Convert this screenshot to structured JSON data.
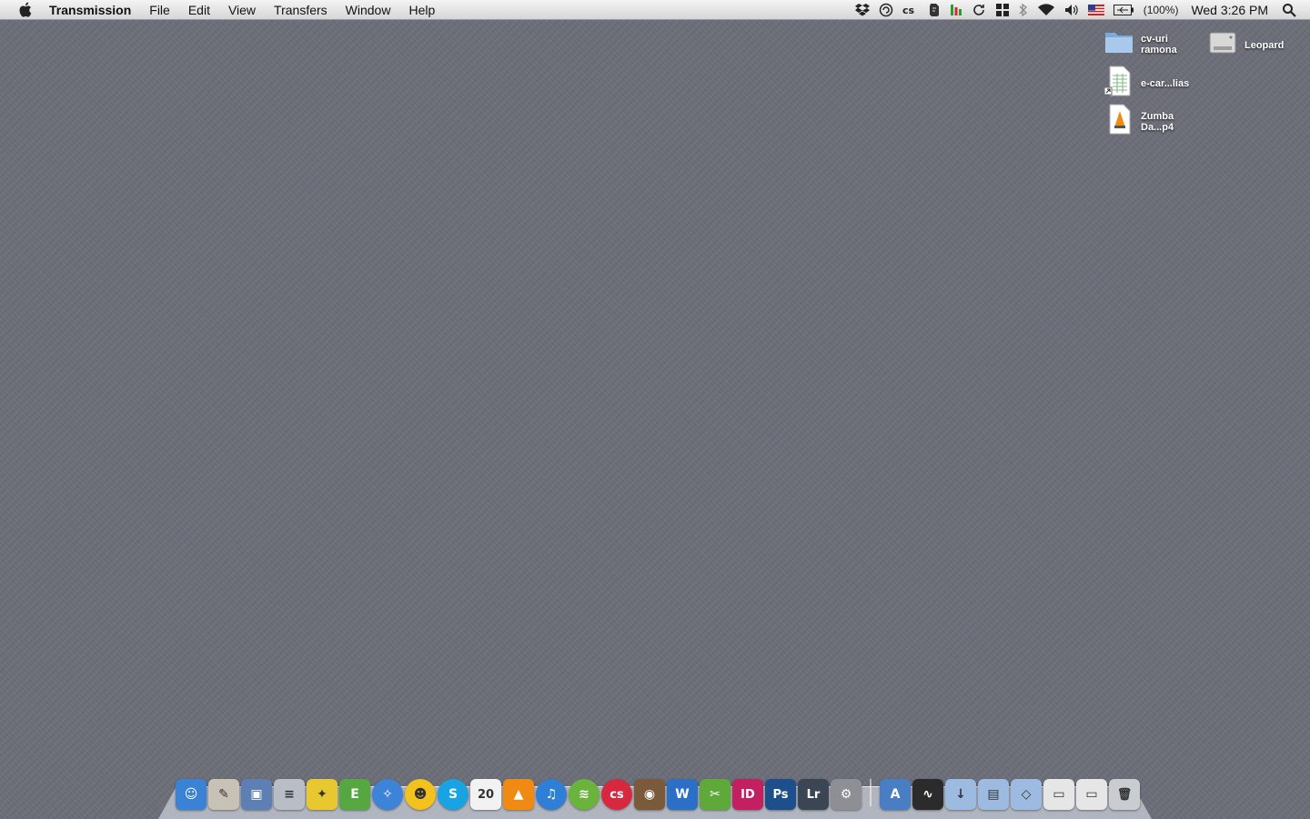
{
  "menubar": {
    "app_name": "Transmission",
    "menus": [
      "File",
      "Edit",
      "View",
      "Transfers",
      "Window",
      "Help"
    ],
    "battery_text": "(100%)",
    "clock": "Wed 3:26 PM"
  },
  "desktop": {
    "icons": [
      {
        "label": "cv-uri ramona",
        "icon": "folder-icon"
      },
      {
        "label": "Leopard",
        "icon": "hard-drive-icon"
      },
      {
        "label": "e-car...lias",
        "icon": "spreadsheet-file-icon"
      },
      {
        "label": "Zumba Da...p4",
        "icon": "vlc-video-file-icon"
      }
    ]
  },
  "dock": {
    "apps": [
      {
        "name": "Finder",
        "icon": "finder-icon",
        "glyph": "☺",
        "color": "#3a82d6"
      },
      {
        "name": "Script Editor",
        "icon": "script-icon",
        "glyph": "✎",
        "color": "#c8c2b6"
      },
      {
        "name": "Preview",
        "icon": "preview-icon",
        "glyph": "▣",
        "color": "#5d7fb3"
      },
      {
        "name": "News",
        "icon": "newspaper-icon",
        "glyph": "≡",
        "color": "#b9bec6"
      },
      {
        "name": "Twitter",
        "icon": "bird-icon",
        "glyph": "✦",
        "color": "#e8c830"
      },
      {
        "name": "Evernote",
        "icon": "elephant-icon",
        "glyph": "E",
        "color": "#56a642"
      },
      {
        "name": "Safari",
        "icon": "compass-icon",
        "glyph": "✧",
        "color": "#3d83d8"
      },
      {
        "name": "Yahoo Messenger",
        "icon": "smiley-icon",
        "glyph": "☻",
        "color": "#f3c21d"
      },
      {
        "name": "Skype",
        "icon": "skype-icon",
        "glyph": "S",
        "color": "#19a3e3"
      },
      {
        "name": "iCal",
        "icon": "calendar-icon",
        "glyph": "20",
        "color": "#f2f2f2"
      },
      {
        "name": "VLC",
        "icon": "traffic-cone-icon",
        "glyph": "▲",
        "color": "#f08a12"
      },
      {
        "name": "iTunes",
        "icon": "music-note-icon",
        "glyph": "♫",
        "color": "#2f7fd6"
      },
      {
        "name": "Spotify",
        "icon": "spotify-icon",
        "glyph": "≋",
        "color": "#6cb33e"
      },
      {
        "name": "Last.fm",
        "icon": "lastfm-icon",
        "glyph": "cs",
        "color": "#d7283f"
      },
      {
        "name": "iPhoto",
        "icon": "camera-photo-icon",
        "glyph": "◉",
        "color": "#7a5a3a"
      },
      {
        "name": "Word",
        "icon": "word-icon",
        "glyph": "W",
        "color": "#2c6fc6"
      },
      {
        "name": "Dreamweaver",
        "icon": "scissors-icon",
        "glyph": "✂",
        "color": "#5fa83a"
      },
      {
        "name": "InDesign",
        "icon": "indesign-icon",
        "glyph": "ID",
        "color": "#c22060"
      },
      {
        "name": "Photoshop",
        "icon": "photoshop-icon",
        "glyph": "Ps",
        "color": "#1c4f8c"
      },
      {
        "name": "Lightroom",
        "icon": "lightroom-icon",
        "glyph": "Lr",
        "color": "#3a4654"
      },
      {
        "name": "System Preferences",
        "icon": "gear-icon",
        "glyph": "⚙",
        "color": "#8d8f94"
      }
    ],
    "stacks": [
      {
        "name": "Applications",
        "icon": "applications-stack-icon",
        "glyph": "A",
        "color": "#4a7ec4"
      },
      {
        "name": "Activity Monitor",
        "icon": "activity-monitor-icon",
        "glyph": "∿",
        "color": "#2b2b2b"
      },
      {
        "name": "Downloads",
        "icon": "downloads-folder-icon",
        "glyph": "↓",
        "color": "#9dbbe0"
      },
      {
        "name": "Documents",
        "icon": "documents-folder-icon",
        "glyph": "▤",
        "color": "#9dbbe0"
      },
      {
        "name": "Dropbox",
        "icon": "dropbox-folder-icon",
        "glyph": "◇",
        "color": "#9dbbe0"
      },
      {
        "name": "Document stack",
        "icon": "document-stack-icon",
        "glyph": "▭",
        "color": "#e6e6e6"
      },
      {
        "name": "Document stack 2",
        "icon": "document-stack-icon",
        "glyph": "▭",
        "color": "#e6e6e6"
      },
      {
        "name": "Trash",
        "icon": "trash-icon",
        "glyph": "🗑",
        "color": "#c9ccd1"
      }
    ]
  }
}
